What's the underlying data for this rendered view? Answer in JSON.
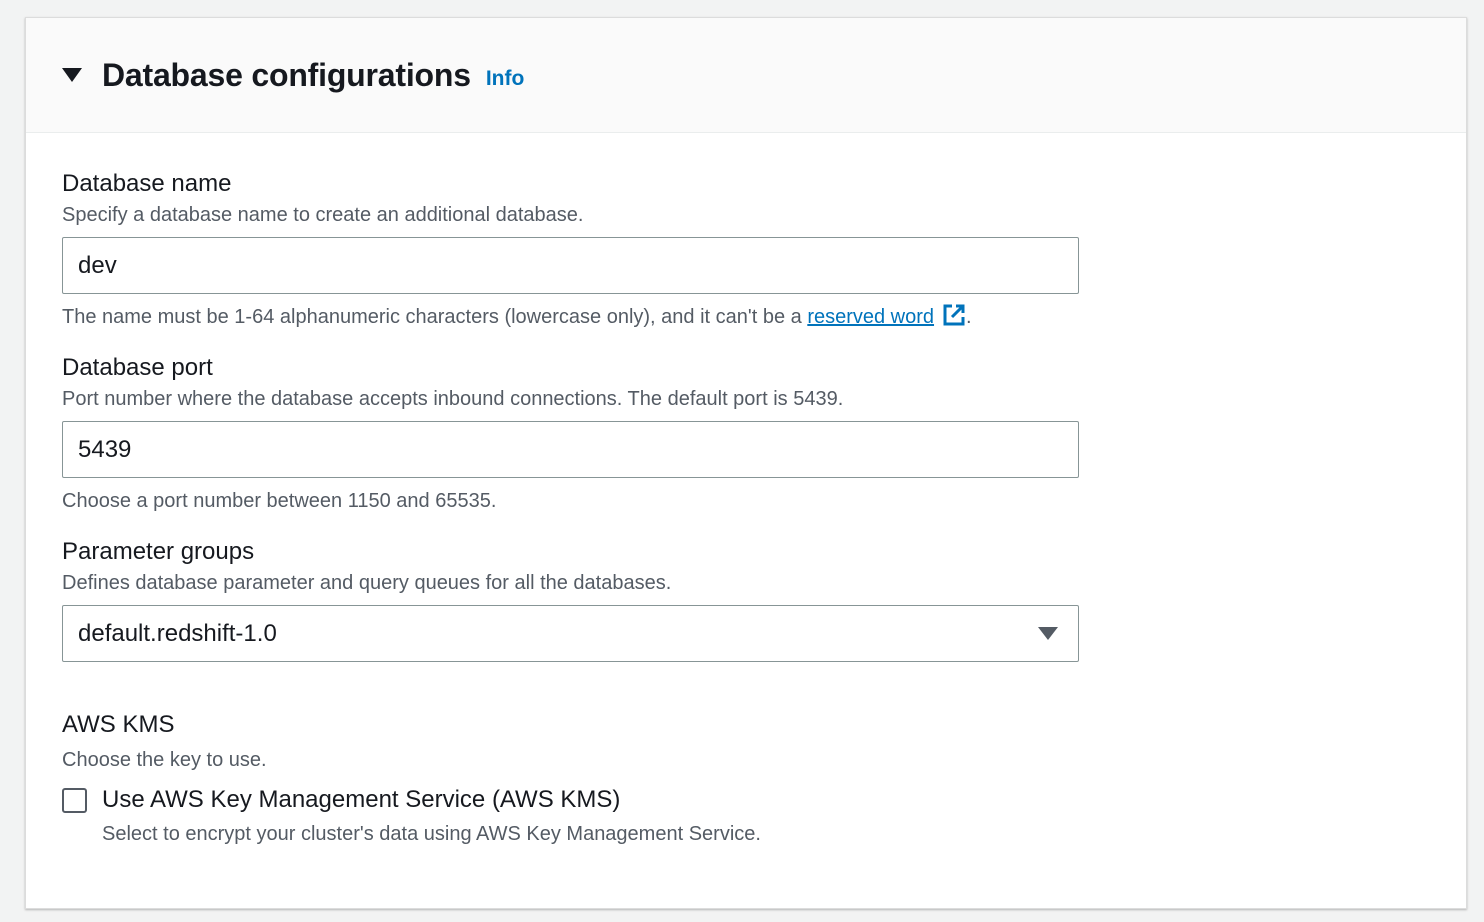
{
  "section": {
    "title": "Database configurations",
    "info_label": "Info"
  },
  "database_name": {
    "label": "Database name",
    "description": "Specify a database name to create an additional database.",
    "value": "dev",
    "constraint_prefix": "The name must be 1-64 alphanumeric characters (lowercase only), and it can't be a ",
    "constraint_link": "reserved word",
    "constraint_suffix": "."
  },
  "database_port": {
    "label": "Database port",
    "description": "Port number where the database accepts inbound connections. The default port is 5439.",
    "value": "5439",
    "constraint": "Choose a port number between 1150 and 65535."
  },
  "parameter_groups": {
    "label": "Parameter groups",
    "description": "Defines database parameter and query queues for all the databases.",
    "selected": "default.redshift-1.0"
  },
  "aws_kms": {
    "label": "AWS KMS",
    "description": "Choose the key to use.",
    "checkbox_label": "Use AWS Key Management Service (AWS KMS)",
    "checkbox_description": "Select to encrypt your cluster's data using AWS Key Management Service.",
    "checked": false
  },
  "icons": {
    "section_toggle": "caret-down-icon",
    "external_link": "external-link-icon",
    "select_dropdown": "caret-down-icon"
  },
  "colors": {
    "link": "#0073bb",
    "text": "#16191f",
    "secondary_text": "#545b64",
    "border": "#879596"
  }
}
